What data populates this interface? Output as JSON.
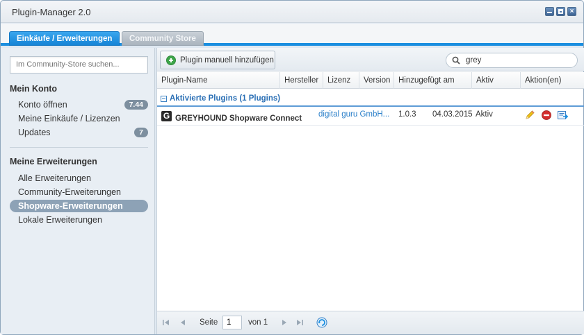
{
  "window": {
    "title": "Plugin-Manager 2.0"
  },
  "tabs": [
    {
      "label": "Einkäufe / Erweiterungen",
      "active": true
    },
    {
      "label": "Community Store",
      "active": false
    }
  ],
  "sidebar": {
    "search_placeholder": "Im Community-Store suchen...",
    "account_title": "Mein Konto",
    "account_items": [
      {
        "label": "Konto öffnen",
        "badge": "7.44"
      },
      {
        "label": "Meine Einkäufe / Lizenzen",
        "badge": ""
      },
      {
        "label": "Updates",
        "badge": "7"
      }
    ],
    "extensions_title": "Meine Erweiterungen",
    "extension_items": [
      {
        "label": "Alle Erweiterungen",
        "selected": false
      },
      {
        "label": "Community-Erweiterungen",
        "selected": false
      },
      {
        "label": "Shopware-Erweiterungen",
        "selected": true
      },
      {
        "label": "Lokale Erweiterungen",
        "selected": false
      }
    ]
  },
  "toolbar": {
    "add_button_label": "Plugin manuell hinzufügen",
    "search_value": "grey"
  },
  "grid": {
    "columns": [
      "Plugin-Name",
      "Hersteller",
      "Lizenz",
      "Version",
      "Hinzugefügt am",
      "Aktiv",
      "Aktion(en)"
    ],
    "group_label": "Aktivierte Plugins (1 Plugins)",
    "rows": [
      {
        "name": "GREYHOUND Shopware Connect",
        "manufacturer": "digital guru GmbH...",
        "license": "",
        "version": "1.0.3",
        "added": "04.03.2015",
        "active": "Aktiv",
        "logo_letter": "G"
      }
    ]
  },
  "pager": {
    "page_label": "Seite",
    "page_value": "1",
    "of_label": "von 1"
  },
  "colors": {
    "accent": "#1a8ee0",
    "link": "#2a7fc9",
    "selected_nav": "#8da2b6"
  }
}
